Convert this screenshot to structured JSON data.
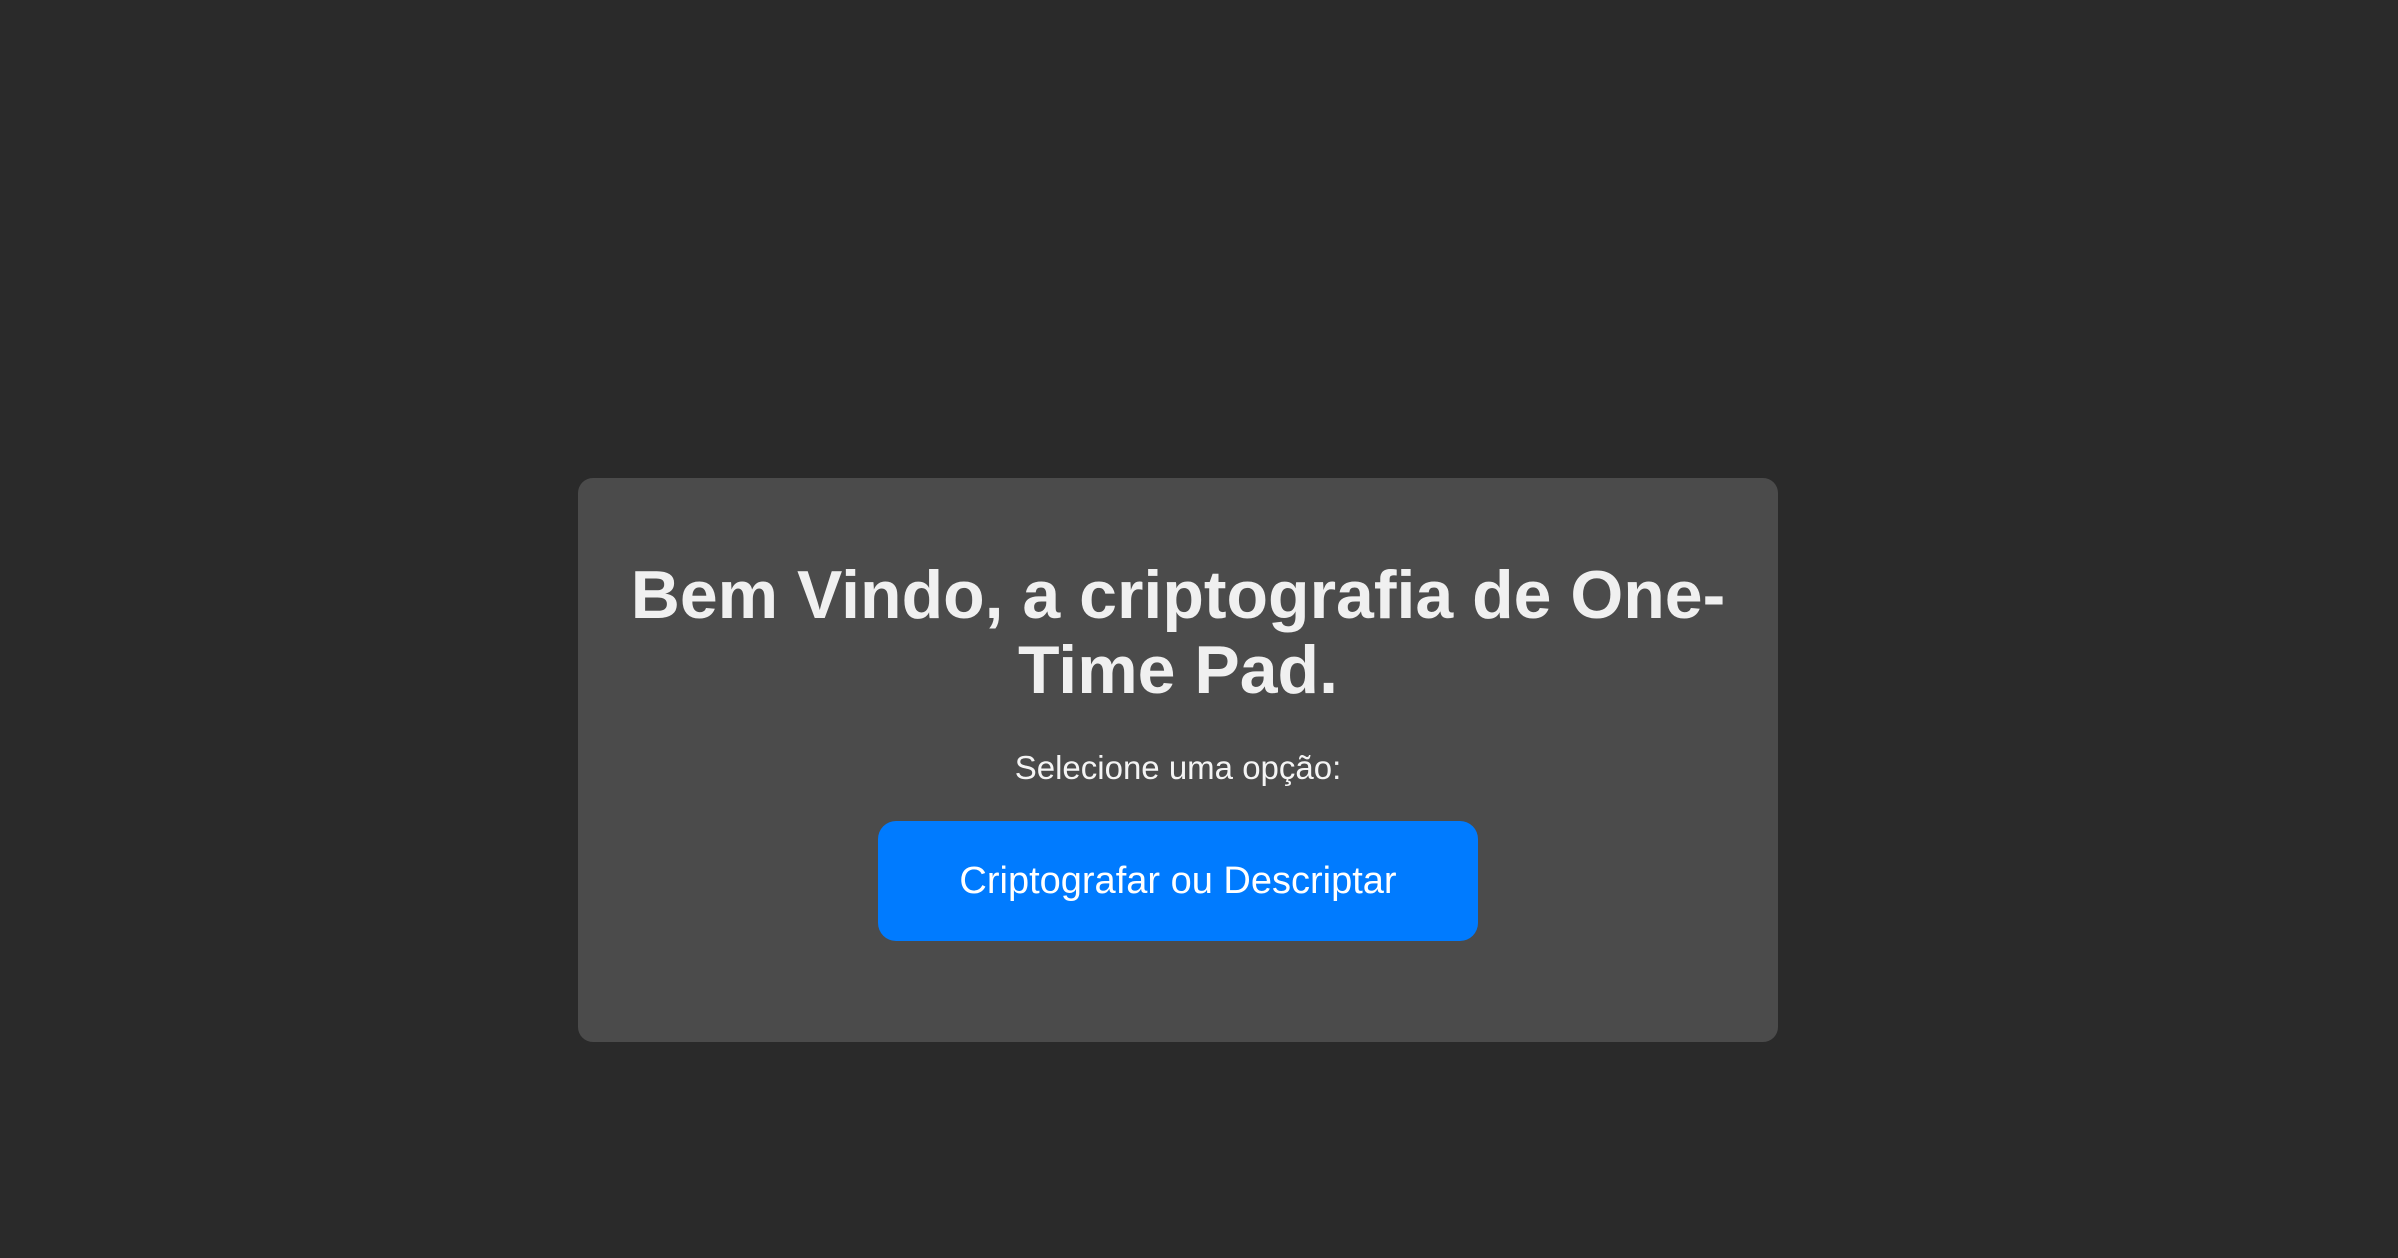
{
  "welcome": {
    "title": "Bem Vindo, a criptografia de One-Time Pad.",
    "subtitle": "Selecione uma opção:",
    "primary_button_label": "Criptografar ou Descriptar"
  },
  "colors": {
    "background": "#2a2a2a",
    "card": "#4b4b4b",
    "accent": "#007bff",
    "text": "#f0f0f0"
  }
}
